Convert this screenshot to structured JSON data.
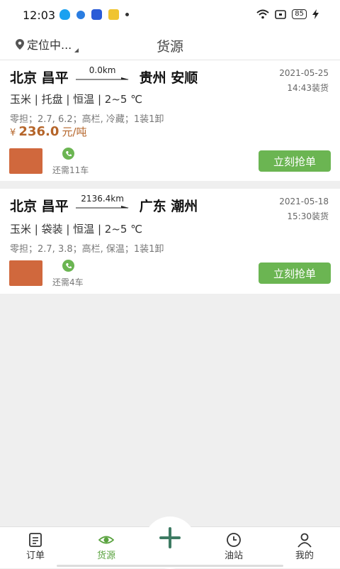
{
  "status_bar": {
    "time": "12:03",
    "battery": "85"
  },
  "header": {
    "location": "定位中...",
    "title": "货源"
  },
  "cards": [
    {
      "origin": "北京 昌平",
      "distance": "0.0km",
      "destination": "贵州 安顺",
      "date": "2021-05-25",
      "load_time": "14:43装货",
      "goods": "玉米 | 托盘 | 恒温 | 2~5 ℃",
      "spec": "零担；2.7, 6.2；高栏, 冷藏；1装1卸",
      "price_symbol": "¥",
      "price_value": "236.0",
      "price_unit": "元/吨",
      "remain": "还需11车",
      "button_label": "立刻抢单"
    },
    {
      "origin": "北京 昌平",
      "distance": "2136.4km",
      "destination": "广东 潮州",
      "date": "2021-05-18",
      "load_time": "15:30装货",
      "goods": "玉米 | 袋装 | 恒温 | 2~5 ℃",
      "spec": "零担；2.7, 3.8；高栏, 保温；1装1卸",
      "remain": "还需4车",
      "button_label": "立刻抢单"
    }
  ],
  "tabs": [
    {
      "label": "订单",
      "icon": "order-list-icon"
    },
    {
      "label": "货源",
      "icon": "eye-icon",
      "active": true
    },
    {
      "label": "",
      "icon": "plus-icon"
    },
    {
      "label": "油站",
      "icon": "clock-icon"
    },
    {
      "label": "我的",
      "icon": "user-icon"
    }
  ],
  "colors": {
    "accent": "#6bb552",
    "price": "#b5652a",
    "avatar": "#d0683d"
  }
}
